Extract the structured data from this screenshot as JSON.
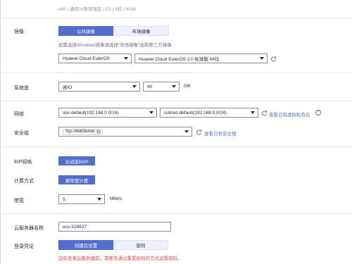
{
  "spec_summary": "x86 | 通用计算增强型 | C3 | 4核 | 8GiB",
  "image": {
    "label": "镜像",
    "tab_public": "公共镜像",
    "tab_market": "市场镜像",
    "hint": "如需选择Windows镜像请选择“市场镜像”选购第三方镜像",
    "os_select": "Huawei Cloud EulerOS",
    "version_select": "Huawei Cloud EulerOS 2.0 标准版 64位"
  },
  "system_disk": {
    "label": "系统盘",
    "type_select": "高IO",
    "size_select": "40",
    "unit": "GB"
  },
  "network": {
    "label": "网络",
    "vpc_select": "vpc-default(192.168.0.0/16)",
    "subnet_select": "subnet-default(192.168.0.0/24)",
    "view_link": "查看已有虚拟私有云"
  },
  "security_group": {
    "label": "安全组",
    "tag": "Sys-WebServer",
    "view_link": "查看已有安全组"
  },
  "eip": {
    "label": "EIP规格",
    "button": "全动态BGP"
  },
  "billing": {
    "label": "计费方式",
    "button": "按带宽计费"
  },
  "bandwidth": {
    "label": "带宽",
    "value": "5",
    "unit": "Mbit/s"
  },
  "server_name": {
    "label": "云服务器名称",
    "value": "ecs-328837"
  },
  "login": {
    "label": "登录凭证",
    "tab_later": "创建后设置",
    "tab_password": "密码",
    "warning": "您在登录云服务器前，需要先通过重置密码的方式设置密码。"
  },
  "colors": {
    "primary": "#526ecc",
    "selected_tab_text": "#ffffff",
    "unselected_tab_bg": "#eef0ff",
    "link": "#526ecc",
    "warning": "#e54545"
  }
}
